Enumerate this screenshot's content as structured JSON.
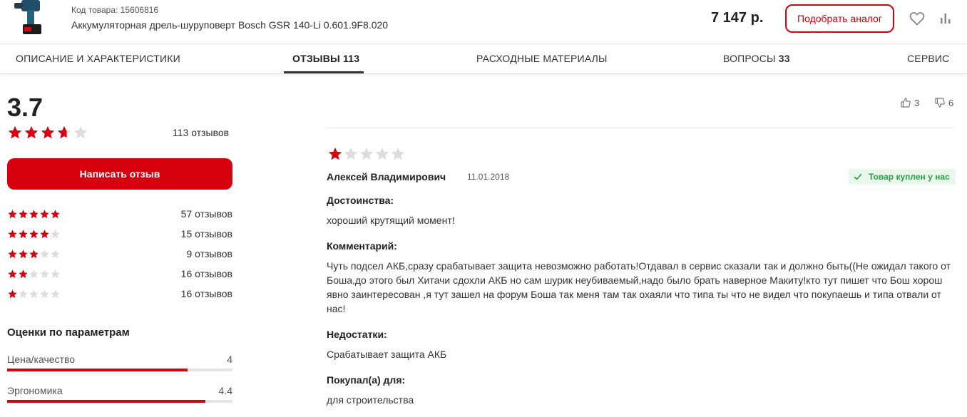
{
  "product": {
    "sku_label": "Код товара: 15606816",
    "title": "Аккумуляторная дрель-шуруповерт Bosch GSR 140-Li 0.601.9F8.020",
    "price": "7 147 р.",
    "analog_button": "Подобрать аналог"
  },
  "tabs": [
    {
      "label": "ОПИСАНИЕ И ХАРАКТЕРИСТИКИ",
      "count": ""
    },
    {
      "label": "ОТЗЫВЫ",
      "count": "113"
    },
    {
      "label": "РАСХОДНЫЕ МАТЕРИАЛЫ",
      "count": ""
    },
    {
      "label": "ВОПРОСЫ",
      "count": "33"
    },
    {
      "label": "СЕРВИС",
      "count": ""
    }
  ],
  "summary": {
    "score": "3.7",
    "score_value": 3.7,
    "reviews_total": "113 отзывов",
    "write_button": "Написать отзыв"
  },
  "distribution": [
    {
      "stars": 5,
      "count": "57 отзывов"
    },
    {
      "stars": 4,
      "count": "15 отзывов"
    },
    {
      "stars": 3,
      "count": "9 отзывов"
    },
    {
      "stars": 2,
      "count": "16 отзывов"
    },
    {
      "stars": 1,
      "count": "16 отзывов"
    }
  ],
  "params": {
    "title": "Оценки по параметрам",
    "items": [
      {
        "name": "Цена/качество",
        "value": "4",
        "fraction": 0.8
      },
      {
        "name": "Эргономика",
        "value": "4.4",
        "fraction": 0.88
      }
    ]
  },
  "review": {
    "likes": "3",
    "dislikes": "6",
    "rating": 1,
    "author": "Алексей Владимирович",
    "date": "11.01.2018",
    "bought_badge": "Товар куплен у нас",
    "pros_title": "Достоинства:",
    "pros_text": "хороший крутящий момент!",
    "comment_title": "Комментарий:",
    "comment_text": "Чуть подсел АКБ,сразу срабатывает защита невозможно работать!Отдавал в сервис сказали так и должно быть((Не ожидал такого от Боша,до этого был Хитачи сдохли АКБ но сам шурик неубиваемый,надо было брать наверное Макиту!кто тут пишет что Бош хорош явно заинтересован ,я тут зашел на форум Боша так меня там так охаяли что типа ты что не видел что покупаешь и типа отвали от нас!",
    "cons_title": "Недостатки:",
    "cons_text": "Срабатывает защита АКБ",
    "usage_title": "Покупал(а) для:",
    "usage_text": "для строительства"
  },
  "colors": {
    "accent": "#d7000f",
    "star_empty": "#dddddd",
    "bought_green": "#2e9e45"
  },
  "icons": [
    "drill-thumbnail",
    "heart-icon",
    "compare-icon",
    "star-icon",
    "thumbs-up-icon",
    "thumbs-down-icon",
    "check-icon"
  ]
}
